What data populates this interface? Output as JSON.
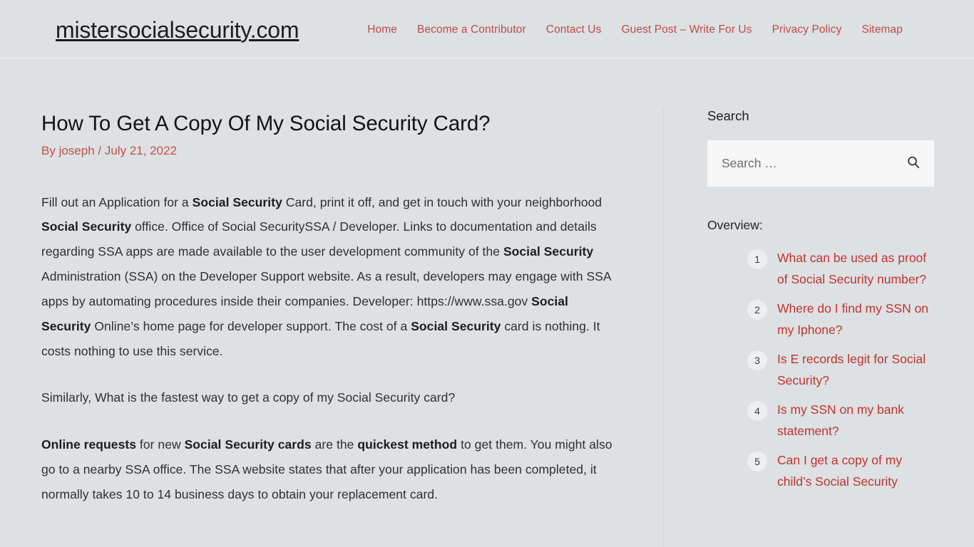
{
  "header": {
    "logo": "mistersocialsecurity.com",
    "nav": [
      {
        "label": "Home"
      },
      {
        "label": "Become a Contributor"
      },
      {
        "label": "Contact Us"
      },
      {
        "label": "Guest Post – Write For Us"
      },
      {
        "label": "Privacy Policy"
      },
      {
        "label": "Sitemap"
      }
    ],
    "accent_color": "#c04a48",
    "background_color": "#dde1e3"
  },
  "post": {
    "title": "How To Get A Copy Of My Social Security Card?",
    "meta_by": "By",
    "author": "joseph",
    "separator": "/",
    "date": "July 21, 2022",
    "paragraphs": [
      {
        "parts": [
          {
            "text": "Fill out an Application for a ",
            "bold": false
          },
          {
            "text": "Social Security",
            "bold": true
          },
          {
            "text": " Card, print it off, and get in touch with your neighborhood ",
            "bold": false
          },
          {
            "text": "Social Security",
            "bold": true
          },
          {
            "text": " office. Office of Social SecuritySSA / Developer. Links to documentation and details regarding SSA apps are made available to the user development community of the ",
            "bold": false
          },
          {
            "text": "Social Security",
            "bold": true
          },
          {
            "text": " Administration (SSA) on the Developer Support website. As a result, developers may engage with SSA apps by automating procedures inside their companies. Developer: https://www.ssa.gov ",
            "bold": false
          },
          {
            "text": "Social Security",
            "bold": true
          },
          {
            "text": " Online’s home page for developer support. The cost of a ",
            "bold": false
          },
          {
            "text": "Social Security",
            "bold": true
          },
          {
            "text": " card is nothing. It costs nothing to use this service.",
            "bold": false
          }
        ]
      },
      {
        "parts": [
          {
            "text": "Similarly, What is the fastest way to get a copy of my Social Security card?",
            "bold": false
          }
        ]
      },
      {
        "parts": [
          {
            "text": "Online requests",
            "bold": true
          },
          {
            "text": " for new ",
            "bold": false
          },
          {
            "text": "Social Security cards",
            "bold": true
          },
          {
            "text": " are the ",
            "bold": false
          },
          {
            "text": "quickest method",
            "bold": true
          },
          {
            "text": " to get them. You might also go to a nearby SSA office. The SSA website states that after your application has been completed, it normally takes 10 to 14 business days to obtain your replacement card.",
            "bold": false
          }
        ]
      }
    ]
  },
  "sidebar": {
    "search_title": "Search",
    "search_value": "",
    "search_placeholder": "Search …",
    "search_icon": "search-icon",
    "overview_label": "Overview:",
    "toc": [
      {
        "num": "1",
        "label": "What can be used as proof of Social Security number?"
      },
      {
        "num": "2",
        "label": "Where do I find my SSN on my Iphone?"
      },
      {
        "num": "3",
        "label": "Is E records legit for Social Security?"
      },
      {
        "num": "4",
        "label": "Is my SSN on my bank statement?"
      },
      {
        "num": "5",
        "label": "Can I get a copy of my child’s Social Security"
      }
    ],
    "link_color": "#c0332f"
  }
}
